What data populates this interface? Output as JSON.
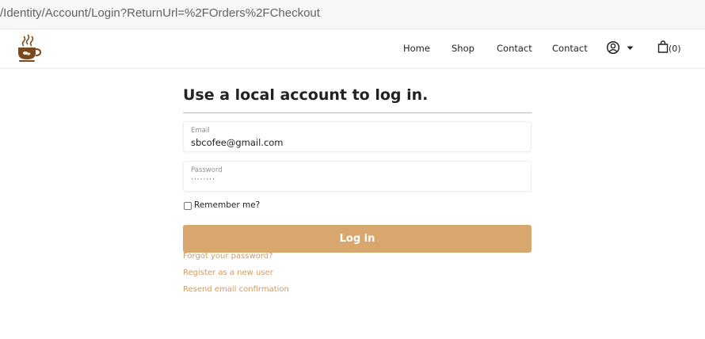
{
  "browser": {
    "url": "/Identity/Account/Login?ReturnUrl=%2FOrders%2FCheckout"
  },
  "navbar": {
    "brand_icon": "coffee-cup-icon",
    "links": [
      "Home",
      "Shop",
      "Contact",
      "Contact"
    ],
    "user_icon": "user-circle-icon",
    "cart_icon": "shopping-bag-icon",
    "cart_count": "(0)"
  },
  "login_form": {
    "title": "Use a local account to log in.",
    "email": {
      "label": "Email",
      "value": "sbcofee@gmail.com"
    },
    "password": {
      "label": "Password",
      "value": "········"
    },
    "remember_label": "Remember me?",
    "remember_checked": false,
    "submit_label": "Log in"
  },
  "links": {
    "forgot_password": "Forgot your password?",
    "register": "Register as a new user",
    "resend_confirmation": "Resend email confirmation"
  },
  "colors": {
    "accent": "#d8a76d",
    "link": "#d39b5f",
    "brand_brown": "#7a4a1e"
  }
}
